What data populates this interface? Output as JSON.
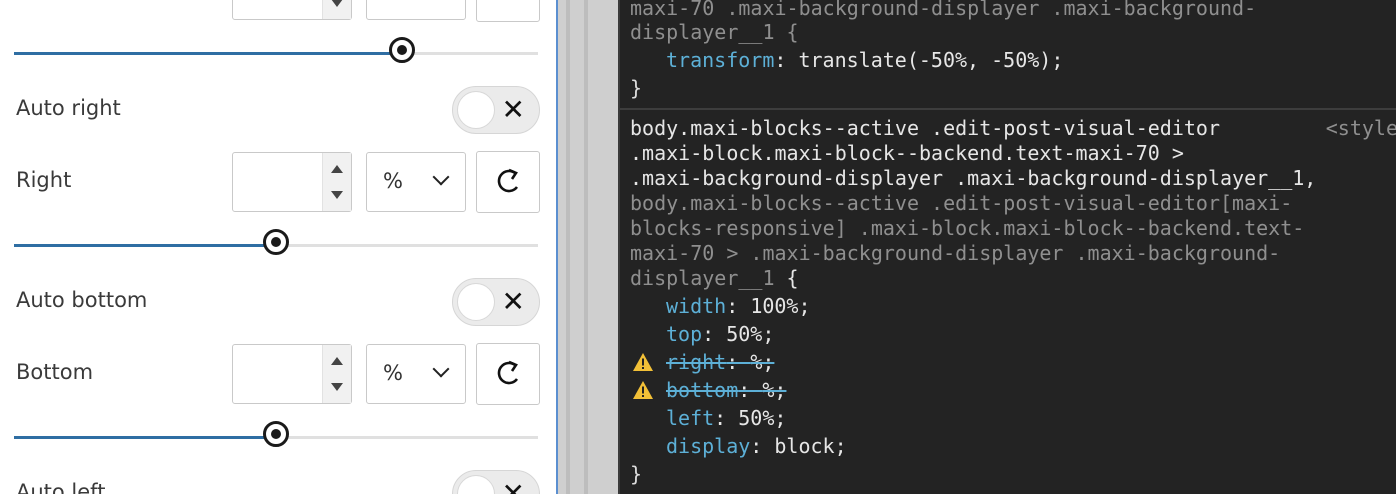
{
  "left_panel": {
    "top_row": {},
    "auto_right": {
      "label": "Auto right",
      "toggle_symbol": "✕"
    },
    "right": {
      "label": "Right",
      "value": "",
      "unit": "%",
      "slider_fraction": 0.5
    },
    "auto_bottom": {
      "label": "Auto bottom",
      "toggle_symbol": "✕"
    },
    "bottom": {
      "label": "Bottom",
      "value": "",
      "unit": "%",
      "slider_fraction": 0.5
    },
    "auto_left": {
      "label": "Auto left",
      "toggle_symbol": "✕"
    },
    "top_slider_fraction": 0.74
  },
  "devtools": {
    "rule1": {
      "selector_lines": [
        "maxi-70 .maxi-background-displayer .maxi-background-",
        "displayer__1 {"
      ],
      "declarations": [
        {
          "prop": "transform",
          "value": "translate(-50%, -50%);"
        }
      ],
      "close": "}"
    },
    "rule2": {
      "source": "<style",
      "selector_active_lines": [
        "body.maxi-blocks--active .edit-post-visual-editor",
        ".maxi-block.maxi-block--backend.text-maxi-70 >",
        ".maxi-background-displayer .maxi-background-displayer__1,"
      ],
      "selector_inactive_lines": [
        "body.maxi-blocks--active .edit-post-visual-editor[maxi-",
        "blocks-responsive] .maxi-block.maxi-block--backend.text-",
        "maxi-70 > .maxi-background-displayer .maxi-background-",
        "displayer__1"
      ],
      "open_brace": " {",
      "declarations": [
        {
          "prop": "width",
          "value": "100%;",
          "warning": false
        },
        {
          "prop": "top",
          "value": "50%;",
          "warning": false
        },
        {
          "prop": "right",
          "value": "%;",
          "warning": true
        },
        {
          "prop": "bottom",
          "value": "%;",
          "warning": true
        },
        {
          "prop": "left",
          "value": "50%;",
          "warning": false
        },
        {
          "prop": "display",
          "value": "block;",
          "warning": false
        }
      ],
      "close": "}"
    }
  },
  "colors": {
    "accent": "#2f6ea3",
    "devtools_bg": "#232323",
    "property": "#5db0d7",
    "warning": "#f2c037"
  }
}
